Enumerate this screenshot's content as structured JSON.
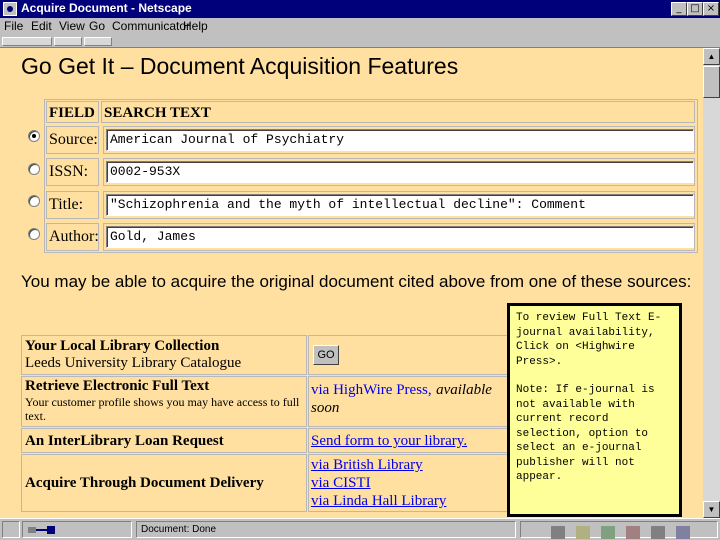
{
  "window": {
    "title": "Acquire Document - Netscape"
  },
  "menu": [
    "File",
    "Edit",
    "View",
    "Go",
    "Communicator",
    "Help"
  ],
  "page": {
    "title": "Go Get It – Document Acquisition Features",
    "table_headers": {
      "field": "FIELD",
      "search_text": "SEARCH TEXT"
    },
    "fields": [
      {
        "label": "Source:",
        "value": "American Journal of Psychiatry",
        "selected": true
      },
      {
        "label": "ISSN:",
        "value": "0002-953X",
        "selected": false
      },
      {
        "label": "Title:",
        "value": "\"Schizophrenia and the myth of intellectual decline\": Comment",
        "selected": false
      },
      {
        "label": "Author:",
        "value": "Gold, James",
        "selected": false
      }
    ],
    "acquire_text": "You may be able to acquire the original document cited above from one of these sources:",
    "sources": {
      "local": {
        "title": "Your Local Library Collection",
        "subtitle": "Leeds University Library Catalogue",
        "button": "GO"
      },
      "fulltext": {
        "title": "Retrieve Electronic Full Text",
        "subtitle": "Your customer profile shows you may have access to full text.",
        "link": "via HighWire Press,",
        "availability": "available soon"
      },
      "ill": {
        "title": "An InterLibrary Loan Request",
        "link": "Send form to your library."
      },
      "delivery": {
        "title": "Acquire Through Document Delivery",
        "links": [
          "via British Library",
          "via CISTI",
          "via Linda Hall Library"
        ]
      }
    }
  },
  "note": {
    "paragraph1": "To review Full Text E-journal availability, Click on <Highwire Press>.",
    "paragraph2": "Note: If e-journal is not available with current record selection, option to select an e-journal publisher will not appear."
  },
  "status": {
    "text": "Document: Done"
  },
  "colors": {
    "content_bg": "#ffe0a0",
    "titlebar": "#00007b",
    "note_bg": "#ffff99",
    "link": "#0000ee"
  },
  "icons": [
    "netscape-icon",
    "minimize-icon",
    "maximize-icon",
    "close-icon",
    "security-lock-icon",
    "network-icon",
    "component-icons"
  ]
}
